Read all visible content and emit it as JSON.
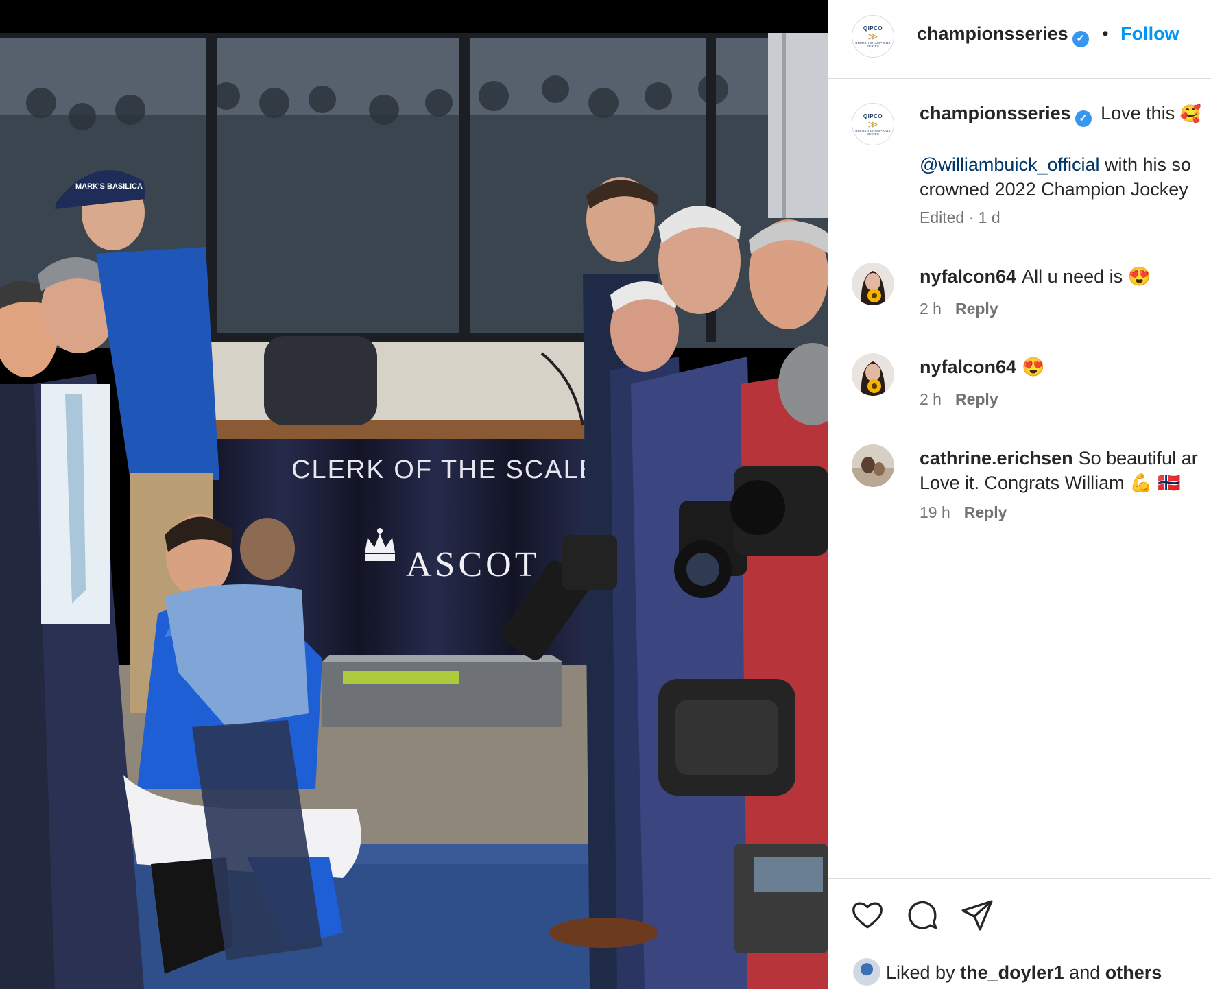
{
  "post": {
    "account": "championsseries",
    "follow_label": "Follow",
    "header_separator": "•",
    "logo": {
      "top": "QIPCO",
      "bottom": "BRITISH CHAMPIONS SERIES"
    }
  },
  "photo": {
    "sign_clerk": "CLERK OF THE SCALE",
    "sign_brand": "ASCOT",
    "cap_text": "MARK'S BASILICA"
  },
  "caption": {
    "username": "championsseries",
    "text": "Love this",
    "emoji": "🥰",
    "mention": "@williambuick_official",
    "text_after_mention": "with his so",
    "line2": "crowned 2022 Champion Jockey",
    "meta": "Edited · 1 d"
  },
  "comments": [
    {
      "username": "nyfalcon64",
      "text": "All u need is 😍",
      "time": "2 h",
      "reply_label": "Reply"
    },
    {
      "username": "nyfalcon64",
      "text": "😍",
      "time": "2 h",
      "reply_label": "Reply"
    },
    {
      "username": "cathrine.erichsen",
      "text": "So beautiful ar",
      "text_line2": "Love it. Congrats William 💪 🇳🇴",
      "time": "19 h",
      "reply_label": "Reply"
    }
  ],
  "actions": {
    "icons": [
      "heart-icon",
      "comment-icon",
      "share-icon"
    ]
  },
  "likes": {
    "prefix": "Liked by",
    "user": "the_doyler1",
    "middle": "and",
    "suffix": "others"
  },
  "colors": {
    "link_blue": "#0095f6",
    "mention_blue": "#00376b",
    "verified_blue": "#3797f0",
    "meta_gray": "#737373",
    "divider": "#dbdbdb",
    "jockey_silks": "#1f5fd6",
    "banner_navy": "#1c1f3a"
  }
}
